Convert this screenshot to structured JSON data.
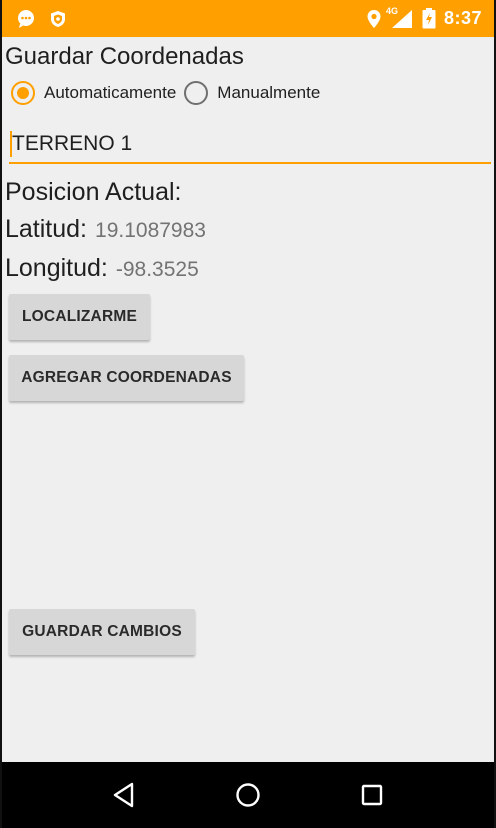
{
  "status_bar": {
    "time": "8:37",
    "network": "4G",
    "icons": [
      "chat-icon",
      "shield-icon",
      "location-icon",
      "signal-icon",
      "battery-icon"
    ]
  },
  "app": {
    "title": "Guardar Coordenadas"
  },
  "mode": {
    "options": [
      {
        "label": "Automaticamente",
        "checked": true
      },
      {
        "label": "Manualmente",
        "checked": false
      }
    ]
  },
  "terrain_input": {
    "value": "TERRENO 1"
  },
  "position": {
    "title": "Posicion Actual:",
    "lat_label": "Latitud:",
    "lat_value": "19.1087983",
    "lon_label": "Longitud:",
    "lon_value": "-98.3525"
  },
  "buttons": {
    "locate": "LOCALIZARME",
    "add_coords": "AGREGAR COORDENADAS",
    "save_changes": "GUARDAR CAMBIOS"
  },
  "colors": {
    "accent": "#ff9f00",
    "background": "#efefef",
    "button": "#d7d7d7"
  },
  "nav": {
    "icons": [
      "back-icon",
      "home-icon",
      "recents-icon"
    ]
  }
}
